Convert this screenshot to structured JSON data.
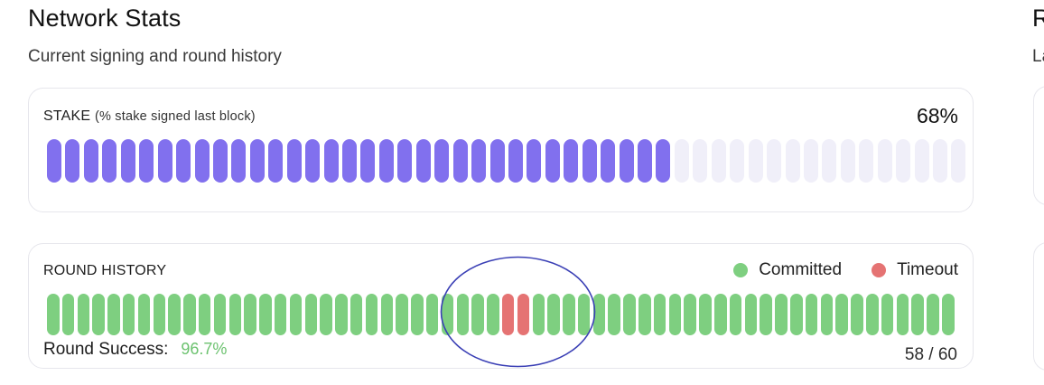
{
  "header": {
    "title": "Network Stats",
    "subtitle": "Current signing and round history",
    "next_title_fragment": "R",
    "next_subtitle_fragment": "La"
  },
  "stake": {
    "label": "STAKE",
    "label_note": "(% stake signed last block)",
    "percent_text": "68%",
    "signed_fraction": 0.68,
    "total_bars": 50,
    "signed_bars": 34,
    "signed_color": "#8170ee",
    "unsigned_color": "#f0eff9"
  },
  "rounds": {
    "label": "ROUND HISTORY",
    "legend": [
      {
        "label": "Committed",
        "color": "#7ecf80"
      },
      {
        "label": "Timeout",
        "color": "#e57373"
      }
    ],
    "history": [
      "C",
      "C",
      "C",
      "C",
      "C",
      "C",
      "C",
      "C",
      "C",
      "C",
      "C",
      "C",
      "C",
      "C",
      "C",
      "C",
      "C",
      "C",
      "C",
      "C",
      "C",
      "C",
      "C",
      "C",
      "C",
      "C",
      "C",
      "C",
      "C",
      "C",
      "T",
      "T",
      "C",
      "C",
      "C",
      "C",
      "C",
      "C",
      "C",
      "C",
      "C",
      "C",
      "C",
      "C",
      "C",
      "C",
      "C",
      "C",
      "C",
      "C",
      "C",
      "C",
      "C",
      "C",
      "C",
      "C",
      "C",
      "C",
      "C",
      "C"
    ],
    "success_label": "Round Success:",
    "success_value": "96.7%",
    "count_text": "58 / 60"
  },
  "annotation": {
    "color": "#3a3fb5",
    "shape": "ellipse"
  }
}
